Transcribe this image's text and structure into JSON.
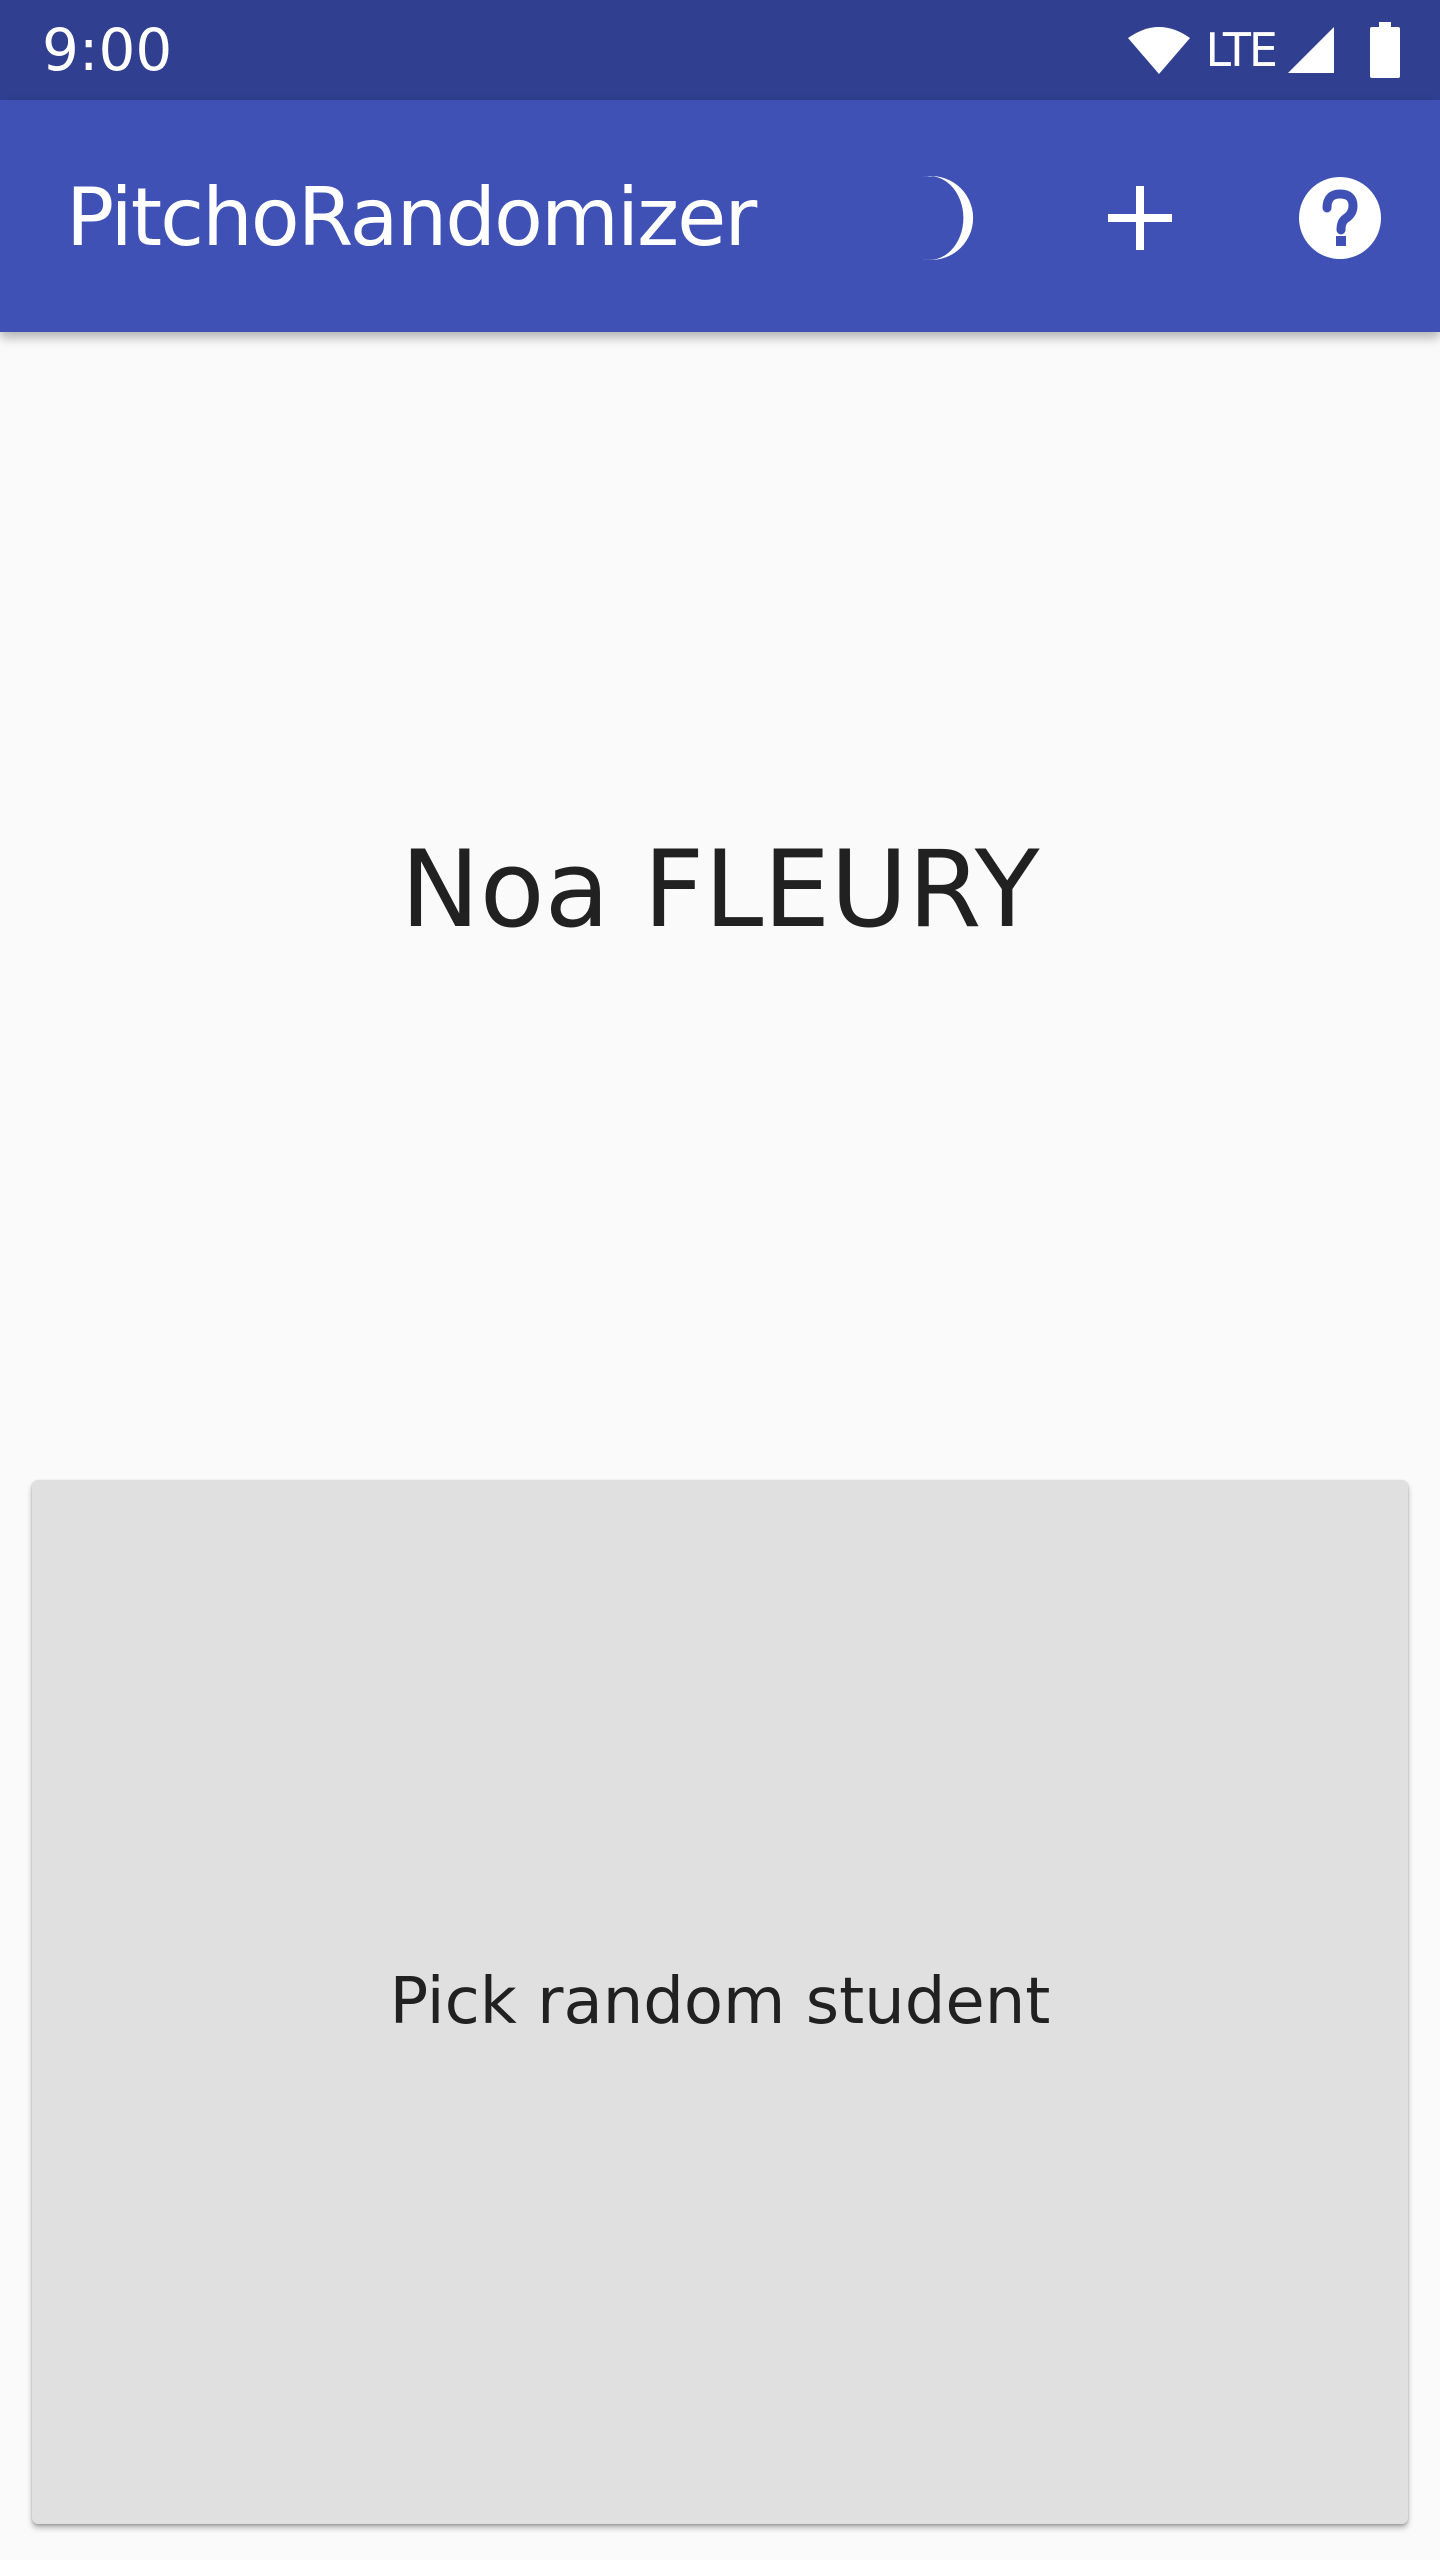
{
  "status_bar": {
    "time": "9:00",
    "network": "LTE",
    "icons": [
      "wifi-icon",
      "cell-signal-icon",
      "battery-icon"
    ]
  },
  "app_bar": {
    "title": "PitchoRandomizer",
    "actions": [
      "moon-icon",
      "add-icon",
      "help-icon"
    ]
  },
  "main": {
    "student_name": "Noa FLEURY",
    "pick_button_label": "Pick random student"
  },
  "colors": {
    "status_bar": "#303f8f",
    "app_bar": "#3f51b5",
    "background": "#fafafa",
    "button": "#e0e0e0",
    "text_primary": "#212121"
  }
}
